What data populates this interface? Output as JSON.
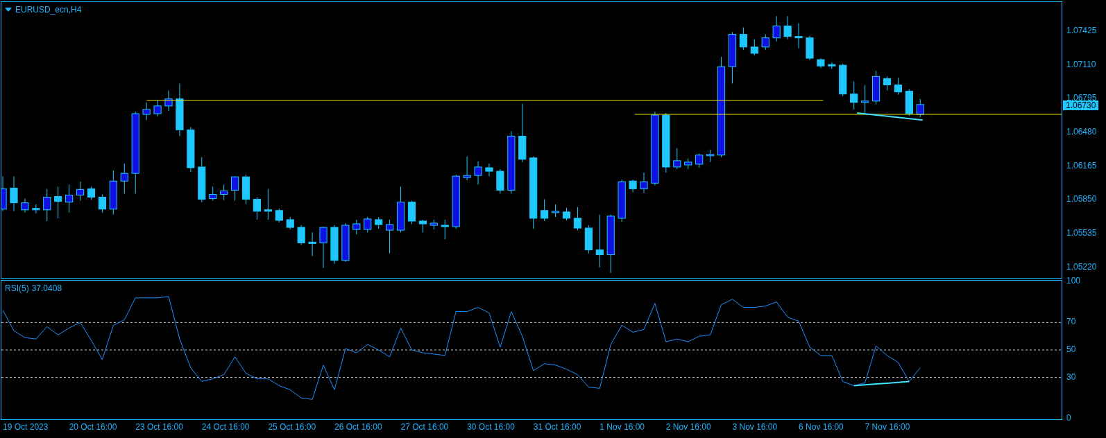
{
  "chart": {
    "title": "EURUSD_ecn,H4",
    "price_axis": {
      "labels": [
        "1.07425",
        "1.07110",
        "1.06795",
        "1.06480",
        "1.06165",
        "1.05850",
        "1.05535",
        "1.05220"
      ],
      "current_price": "1.06730"
    }
  },
  "indicator": {
    "reading": "37.0408",
    "chart_data": {
      "type": "line",
      "grid": true,
      "ylim": [
        0,
        100
      ],
      "yticks": [
        100,
        70,
        50,
        30,
        0
      ],
      "series": [
        {
          "name": "RSI(5)",
          "color": "#1e90ff",
          "values": [
            79,
            64,
            59,
            58,
            67,
            61,
            66,
            70,
            57,
            43,
            68,
            72,
            88,
            88,
            88,
            89,
            58,
            37,
            27,
            29,
            32,
            45,
            33,
            29,
            29,
            24,
            21,
            15,
            14,
            39,
            21,
            51,
            48,
            54,
            50,
            45,
            66,
            50,
            48,
            47,
            46,
            78,
            78,
            81,
            77,
            52,
            78,
            60,
            35,
            40,
            39,
            36,
            32,
            23,
            22,
            54,
            68,
            63,
            65,
            84,
            56,
            58,
            56,
            60,
            61,
            83,
            87,
            81,
            81,
            82,
            85,
            74,
            71,
            52,
            46,
            46,
            27,
            24,
            26,
            53,
            46,
            41,
            27,
            37
          ]
        },
        {
          "color": "#40e0ff",
          "values": [
            null,
            null,
            null,
            null,
            null,
            null,
            null,
            null,
            null,
            null,
            null,
            null,
            null,
            null,
            null,
            null,
            null,
            null,
            null,
            null,
            null,
            null,
            null,
            null,
            null,
            null,
            null,
            null,
            null,
            null,
            null,
            null,
            null,
            null,
            null,
            null,
            null,
            null,
            null,
            null,
            null,
            null,
            null,
            null,
            null,
            null,
            null,
            null,
            null,
            null,
            null,
            null,
            null,
            null,
            null,
            null,
            null,
            null,
            null,
            null,
            null,
            null,
            null,
            null,
            null,
            null,
            null,
            null,
            null,
            null,
            null,
            null,
            null,
            null,
            null,
            null,
            null,
            24,
            24.6,
            25.2,
            25.8,
            26.4,
            27,
            null
          ]
        }
      ]
    }
  },
  "time_axis": {
    "labels": [
      "19 Oct 2023",
      "20 Oct 16:00",
      "23 Oct 16:00",
      "24 Oct 16:00",
      "25 Oct 16:00",
      "26 Oct 16:00",
      "27 Oct 16:00",
      "30 Oct 16:00",
      "31 Oct 16:00",
      "1 Nov 16:00",
      "2 Nov 16:00",
      "3 Nov 16:00",
      "6 Nov 16:00",
      "7 Nov 16:00"
    ]
  }
}
